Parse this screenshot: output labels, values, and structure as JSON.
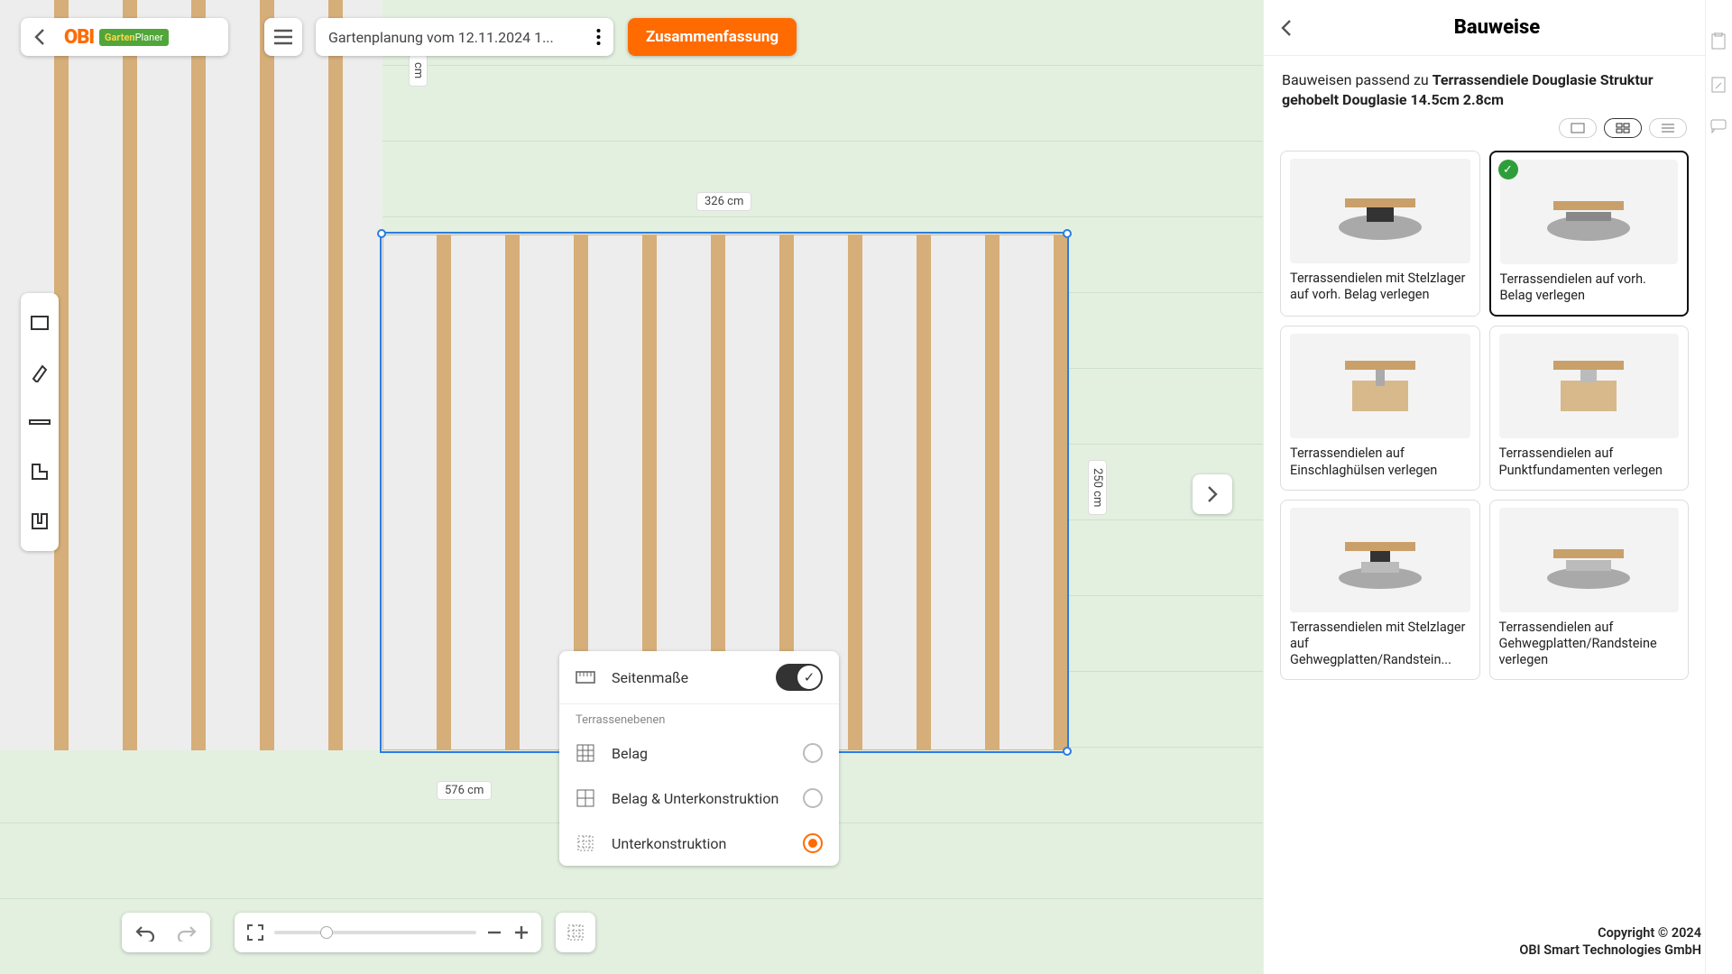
{
  "header": {
    "project_title": "Gartenplanung vom 12.11.2024 1...",
    "summary_btn": "Zusammenfassung",
    "logo_main": "OBI",
    "logo_sub_a": "Garten",
    "logo_sub_b": "Planer"
  },
  "measurements": {
    "top_left_v": "cm",
    "width_label": "326 cm",
    "height_label": "250 cm",
    "bottom_label": "576 cm"
  },
  "layer_popup": {
    "dimensions": "Seitenmaße",
    "section": "Terrassenebenen",
    "opt1": "Belag",
    "opt2": "Belag & Unterkonstruktion",
    "opt3": "Unterkonstruktion"
  },
  "side": {
    "title": "Bauweise",
    "sub_a": "Bauweisen passend zu ",
    "sub_b": "Terrassendiele Douglasie Struktur gehobelt Douglasie 14.5cm 2.8cm",
    "cards": [
      "Terrassendielen mit Stelzlager auf vorh. Belag verlegen",
      "Terrassendielen auf vorh. Belag verlegen",
      "Terrassendielen auf Einschlaghülsen verlegen",
      "Terrassendielen auf Punktfundamenten verlegen",
      "Terrassendielen mit Stelzlager auf Gehwegplatten/Randstein...",
      "Terrassendielen auf Gehwegplatten/Randsteine verlegen"
    ]
  },
  "footer": {
    "copy1": "Copyright © 2024",
    "copy2": "OBI Smart Technologies GmbH"
  },
  "icons": {
    "rect_tool": "rectangle-tool",
    "pen_tool": "pen-tool",
    "line_tool": "line-tool",
    "l_tool": "l-shape-tool",
    "u_tool": "u-shape-tool"
  }
}
